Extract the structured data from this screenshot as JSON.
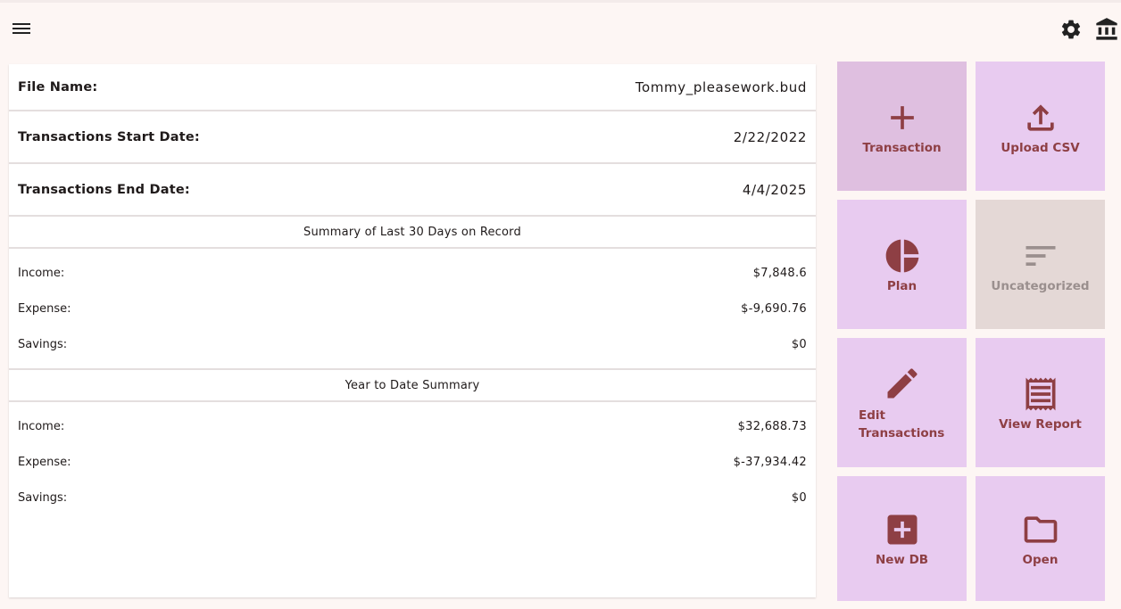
{
  "header": {
    "menu_icon": "menu-icon",
    "settings_icon": "gear-icon",
    "bank_icon": "bank-icon"
  },
  "file_info": {
    "file_name_label": "File Name:",
    "file_name_value": "Tommy_pleasework.bud",
    "start_label": "Transactions Start Date:",
    "start_value": "2/22/2022",
    "end_label": "Transactions End Date:",
    "end_value": "4/4/2025"
  },
  "last30": {
    "title": "Summary of Last 30 Days on Record",
    "income_label": "Income:",
    "income_value": "$7,848.6",
    "expense_label": "Expense:",
    "expense_value": "$-9,690.76",
    "savings_label": "Savings:",
    "savings_value": "$0"
  },
  "ytd": {
    "title": "Year to Date Summary",
    "income_label": "Income:",
    "income_value": "$32,688.73",
    "expense_label": "Expense:",
    "expense_value": "$-37,934.42",
    "savings_label": "Savings:",
    "savings_value": "$0"
  },
  "tiles": {
    "transaction": {
      "label": "Transaction",
      "icon": "plus-icon"
    },
    "upload_csv": {
      "label": "Upload CSV",
      "icon": "upload-icon"
    },
    "plan": {
      "label": "Plan",
      "icon": "pie-chart-icon"
    },
    "uncategorized": {
      "label": "Uncategorized",
      "icon": "sort-lines-icon"
    },
    "edit_transactions": {
      "label": "Edit Transactions",
      "icon": "pencil-icon"
    },
    "view_report": {
      "label": "View Report",
      "icon": "receipt-icon"
    },
    "new_db": {
      "label": "New DB",
      "icon": "add-box-icon"
    },
    "open": {
      "label": "Open",
      "icon": "folder-icon"
    }
  },
  "colors": {
    "tile_bg": "#e8cbf0",
    "tile_active_bg": "#dfbfe0",
    "tile_disabled_bg": "#e4d8d6",
    "accent": "#8e3f44",
    "page_bg": "#fdf6f4"
  }
}
